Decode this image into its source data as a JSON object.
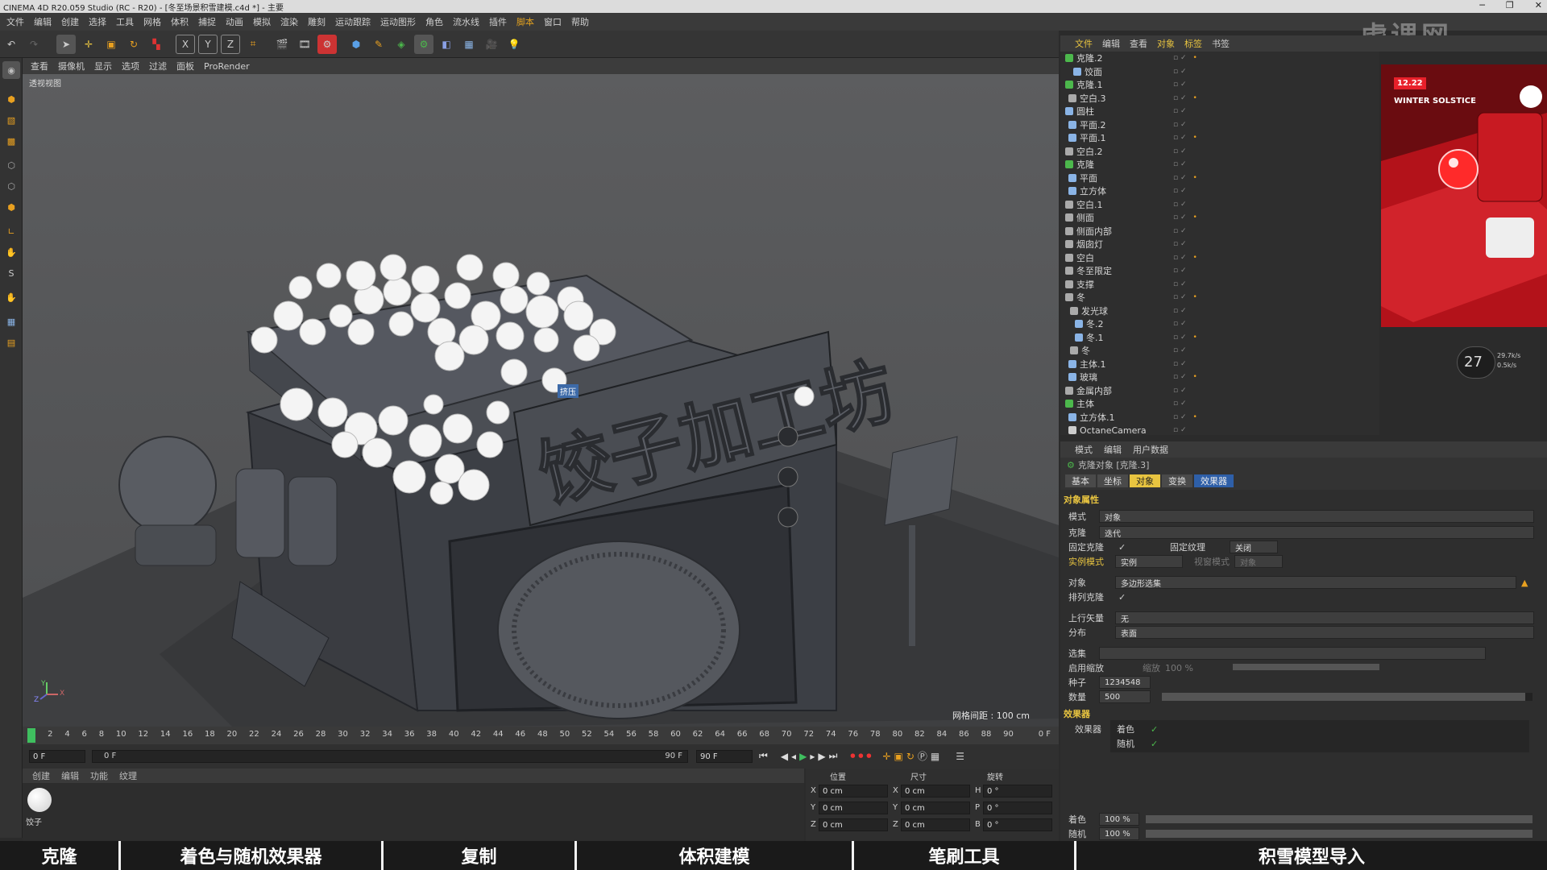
{
  "window": {
    "title": "CINEMA 4D R20.059 Studio (RC - R20) - [冬至场景积雪建模.c4d *] - 主要",
    "controls": [
      "─",
      "❐",
      "✕"
    ]
  },
  "menu": {
    "items": [
      "文件",
      "编辑",
      "创建",
      "选择",
      "工具",
      "网格",
      "体积",
      "捕捉",
      "动画",
      "模拟",
      "渲染",
      "雕刻",
      "运动跟踪",
      "运动图形",
      "角色",
      "流水线",
      "插件",
      "脚本",
      "窗口",
      "帮助"
    ]
  },
  "watermark": "虎课网",
  "viewport": {
    "menu": [
      "查看",
      "摄像机",
      "显示",
      "选项",
      "过滤",
      "面板",
      "ProRender"
    ],
    "label": "透视视图",
    "grid_info": "网格间距 : 100 cm",
    "tooltip": "挤压",
    "axis_y": "Y",
    "axis_z": "Z",
    "axis_x": "X"
  },
  "timeline": {
    "ticks": [
      "0",
      "2",
      "4",
      "6",
      "8",
      "10",
      "12",
      "14",
      "16",
      "18",
      "20",
      "22",
      "24",
      "26",
      "28",
      "30",
      "32",
      "34",
      "36",
      "38",
      "40",
      "42",
      "44",
      "46",
      "48",
      "50",
      "52",
      "54",
      "56",
      "58",
      "60",
      "62",
      "64",
      "66",
      "68",
      "70",
      "72",
      "74",
      "76",
      "78",
      "80",
      "82",
      "84",
      "86",
      "88",
      "90"
    ],
    "end_label": "0 F",
    "frame_start": "0 F",
    "frame_current": "0 F",
    "frame_slider_end": "90 F",
    "frame_end": "90 F"
  },
  "materials": {
    "menu": [
      "创建",
      "编辑",
      "功能",
      "纹理"
    ],
    "item_label": "饺子"
  },
  "coords": {
    "headers": [
      "位置",
      "尺寸",
      "旋转"
    ],
    "rows": [
      {
        "axis": "X",
        "pos": "0 cm",
        "size_axis": "X",
        "size": "0 cm",
        "rot_axis": "H",
        "rot": "0 °"
      },
      {
        "axis": "Y",
        "pos": "0 cm",
        "size_axis": "Y",
        "size": "0 cm",
        "rot_axis": "P",
        "rot": "0 °"
      },
      {
        "axis": "Z",
        "pos": "0 cm",
        "size_axis": "Z",
        "size": "0 cm",
        "rot_axis": "B",
        "rot": "0 °"
      }
    ]
  },
  "object_manager": {
    "menu": [
      "文件",
      "编辑",
      "查看",
      "对象",
      "标签",
      "书签"
    ],
    "objects": [
      "克隆.2",
      "饺面",
      "克隆.1",
      "空白.3",
      "圆柱",
      "平面.2",
      "平面.1",
      "空白.2",
      "克隆",
      "平面",
      "立方体",
      "空白.1",
      "侧面",
      "侧面内部",
      "烟囱灯",
      "空白",
      "冬至限定",
      "支撑",
      "冬",
      "发光球",
      "冬.2",
      "冬.1",
      "冬",
      "主体.1",
      "玻璃",
      "金属内部",
      "主体",
      "立方体.1",
      "OctaneCamera"
    ]
  },
  "preview": {
    "badge_top": "12.22",
    "badge_text": "WINTER SOLSTICE",
    "stats_main": "27",
    "stats_a": "29.7k/s",
    "stats_b": "0.5k/s"
  },
  "attributes": {
    "menu": [
      "模式",
      "编辑",
      "用户数据"
    ],
    "object_title": "克隆对象 [克隆.3]",
    "tabs": [
      "基本",
      "坐标",
      "对象",
      "变换",
      "效果器"
    ],
    "section_object": "对象属性",
    "mode_label": "模式",
    "mode_value": "对象",
    "clones_label": "克隆",
    "clones_value": "迭代",
    "fix_clone_label": "固定克隆",
    "fix_texture_label": "固定纹理",
    "fix_texture_value": "关闭",
    "instance_mode_label": "实例模式",
    "instance_mode_value": "实例",
    "viewport_mode_label": "视窗模式",
    "viewport_mode_value": "对象",
    "object_label": "对象",
    "object_value": "多边形选集",
    "arrange_label": "排列克隆",
    "upvector_label": "上行矢量",
    "upvector_value": "无",
    "distribution_label": "分布",
    "distribution_value": "表面",
    "selection_label": "选集",
    "scale_label": "启用缩放",
    "scale_sub": "缩放",
    "scale_value": "100 %",
    "seed_label": "种子",
    "seed_value": "1234548",
    "count_label": "数量",
    "count_value": "500",
    "count_fraction": 0.98,
    "section_effectors": "效果器",
    "effectors_label": "效果器",
    "effector_1": "着色",
    "effector_2": "随机",
    "strength_1_label": "着色",
    "strength_1_value": "100 %",
    "strength_2_label": "随机",
    "strength_2_value": "100 %"
  },
  "bottom_captions": [
    "克隆",
    "着色与随机效果器",
    "复制",
    "体积建模",
    "笔刷工具",
    "积雪模型导入"
  ],
  "colors": {
    "accent": "#e8c440",
    "preview_red": "#c8141c",
    "ui_bg": "#2e2e2e"
  }
}
